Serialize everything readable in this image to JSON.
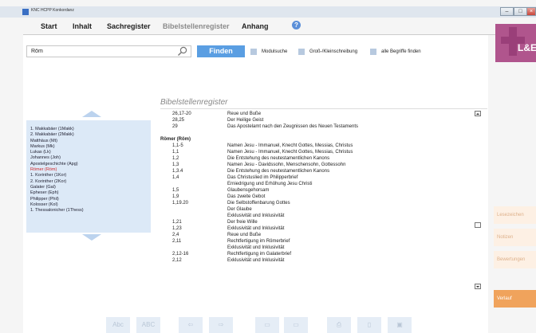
{
  "window": {
    "title": "KNC HCPP Konkordanz",
    "btn_min": "–",
    "btn_max": "□",
    "btn_close": "×"
  },
  "menu": {
    "items": [
      "Start",
      "Inhalt",
      "Sachregister",
      "Bibelstellenregister",
      "Anhang"
    ],
    "help": "?"
  },
  "search": {
    "value": "Röm",
    "button": "Finden",
    "options": [
      "Modulsuche",
      "Groß-/Kleinschreibung",
      "alle Begriffe finden"
    ]
  },
  "logo": {
    "text": "L&E"
  },
  "books": [
    "1. Makkabäer (1Makk)",
    "2. Makkabäer (2Makk)",
    "Matthäus (Mt)",
    "Markus (Mk)",
    "Lukas (Lk)",
    "Johannes (Joh)",
    "Apostelgeschichte (Apg)",
    "Römer (Röm)",
    "1. Korinther (1Kor)",
    "2. Korinther (2Kor)",
    "Galater (Gal)",
    "Epheser (Eph)",
    "Philipper (Phil)",
    "Kolosser (Kol)",
    "1. Thessalonicher (1Thess)"
  ],
  "register": {
    "title": "Bibelstellenregister",
    "rows": [
      {
        "ref": "26,17-20",
        "text": "Reue und Buße"
      },
      {
        "ref": "28,25",
        "text": "Der Heilige Geist"
      },
      {
        "ref": "29",
        "text": "Das Apostelamt nach den Zeugnissen des Neuen Testaments"
      },
      {
        "gap": true
      },
      {
        "heading": "Römer (Röm)"
      },
      {
        "ref": "1,1-5",
        "text": "Namen Jesu - Immanuel, Knecht Gottes, Messias, Christus"
      },
      {
        "ref": "1,1",
        "text": "Namen Jesu - Immanuel, Knecht Gottes, Messias, Christus"
      },
      {
        "ref": "1,2",
        "text": "Die Entstehung des neutestamentlichen Kanons"
      },
      {
        "ref": "1,3",
        "text": "Namen Jesu - Davidssohn, Menschensohn, Gottessohn"
      },
      {
        "ref": "1,3.4",
        "text": "Die Entstehung des neutestamentlichen Kanons"
      },
      {
        "ref": "1,4",
        "text": "Das Christuslied im Philipperbrief"
      },
      {
        "ref": "",
        "text": "Erniedrigung und Erhöhung Jesu Christi"
      },
      {
        "ref": "1,5",
        "text": "Glaubensgehorsam"
      },
      {
        "ref": "1,9",
        "text": "Das zweite Gebot"
      },
      {
        "ref": "1,19.20",
        "text": "Die Selbstoffenbarung Gottes"
      },
      {
        "ref": "",
        "text": "Der Glaube"
      },
      {
        "ref": "",
        "text": "Exklusivität und Inklusivität"
      },
      {
        "ref": "1,21",
        "text": "Der freie Wille"
      },
      {
        "ref": "1,23",
        "text": "Exklusivität und Inklusivität"
      },
      {
        "ref": "2,4",
        "text": "Reue und Buße"
      },
      {
        "ref": "2,11",
        "text": "Rechtfertigung im Römerbrief"
      },
      {
        "ref": "",
        "text": "Exklusivität und Inklusivität"
      },
      {
        "ref": "2,12-16",
        "text": "Rechtfertigung im Galaterbrief"
      },
      {
        "ref": "2,12",
        "text": "Exklusivität und Inklusivität"
      }
    ]
  },
  "side_buttons": [
    "Lesezeichen",
    "Notizen",
    "Bewertungen",
    "Verlauf"
  ],
  "toolbar": [
    "Abc",
    "ABC",
    "⇦",
    "⇨",
    "▭",
    "▭",
    "⎙",
    "▯",
    "▣"
  ],
  "colors": {
    "accent": "#5a9ee2",
    "panel": "#dce9f7",
    "active_book": "#d0262a",
    "orange": "#f0a35c",
    "logo": "#b0558d"
  }
}
